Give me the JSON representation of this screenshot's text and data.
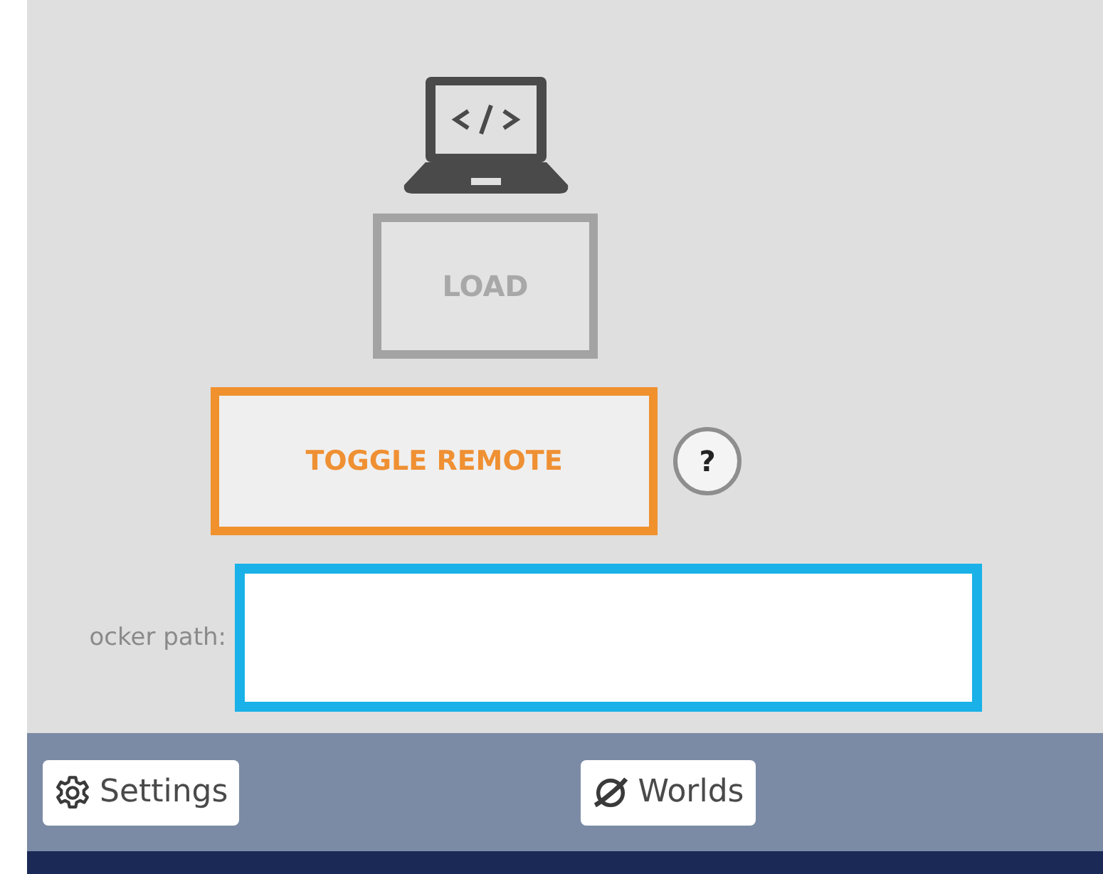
{
  "load_button": {
    "label": "LOAD",
    "disabled": true
  },
  "toggle_button": {
    "label": "TOGGLE REMOTE"
  },
  "help_button": {
    "label": "?"
  },
  "path_field": {
    "label": "ocker path:"
  },
  "bottom_bar": [
    {
      "label": "Settings"
    },
    {
      "label": "Worlds"
    }
  ]
}
